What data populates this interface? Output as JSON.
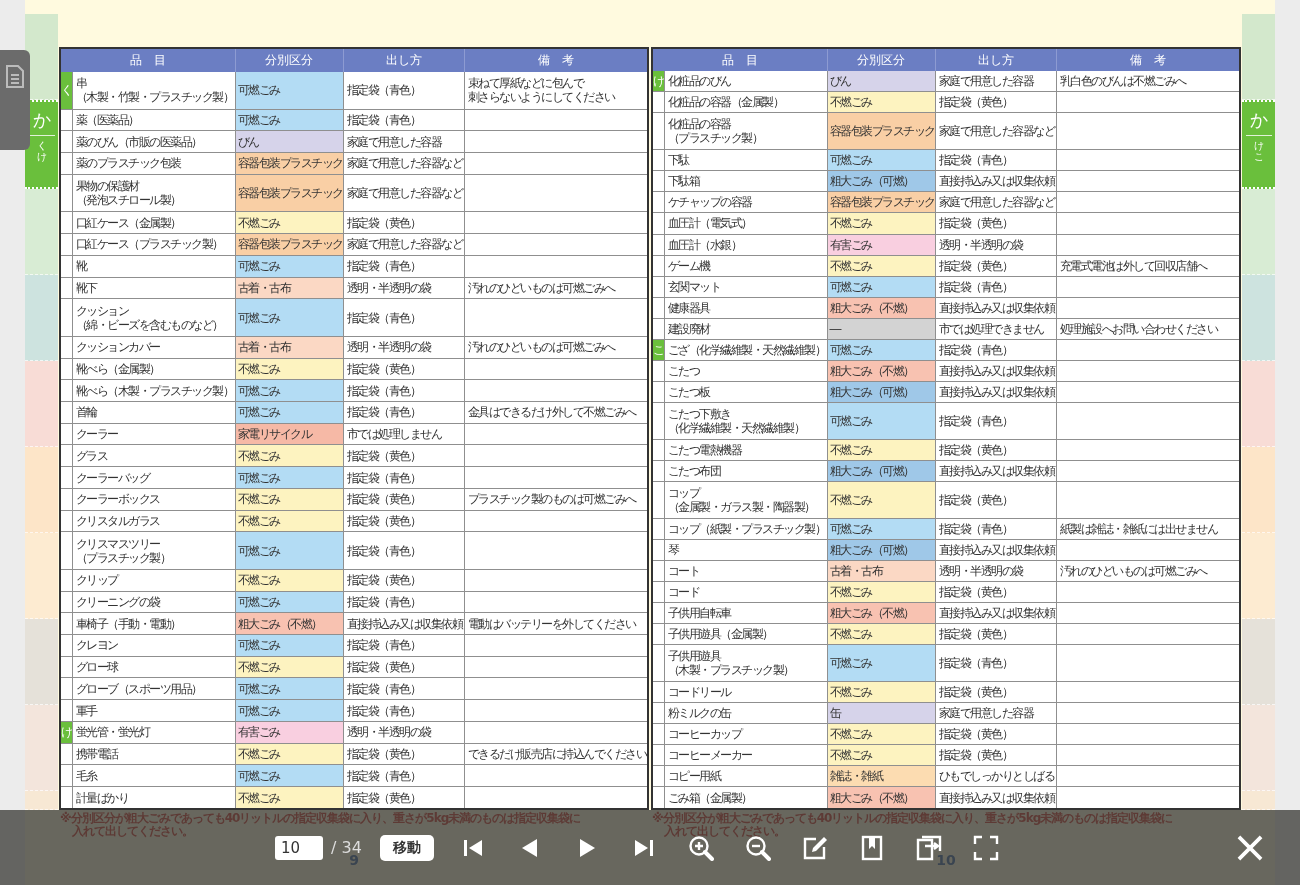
{
  "left_index": [
    {
      "color": "#d3e8cc",
      "selected": false
    },
    {
      "color": "#6abf3c",
      "selected": true,
      "label": "か",
      "sublabel": "くけ"
    },
    {
      "color": "#d8ecd4",
      "selected": false
    },
    {
      "color": "#cde3df",
      "selected": false
    },
    {
      "color": "#f8dcd6",
      "selected": false
    },
    {
      "color": "#fde5c8",
      "selected": false
    },
    {
      "color": "#fdebd1",
      "selected": false
    },
    {
      "color": "#e5e1d9",
      "selected": false
    },
    {
      "color": "#f3e5dc",
      "selected": false
    },
    {
      "color": "#f7e8d4",
      "selected": false
    }
  ],
  "pages": [
    {
      "columns": [
        "品　目",
        "分別区分",
        "出し方",
        "備　考"
      ],
      "rows": [
        {
          "index": "く",
          "item": [
            "串",
            "（木製・竹製・プラスチック製）"
          ],
          "category": "可燃ごみ",
          "color": "#b3dcf4",
          "method": "指定袋（青色）",
          "note": [
            "束ねて厚紙などに包んで",
            "刺さらないようにしてください"
          ]
        },
        {
          "item": "薬（医薬品）",
          "category": "可燃ごみ",
          "color": "#b3dcf4",
          "method": "指定袋（青色）"
        },
        {
          "item": "薬のびん（市販の医薬品）",
          "category": "びん",
          "color": "#d6d3ea",
          "method": "家庭で用意した容器"
        },
        {
          "item": "薬のプラスチック包装",
          "category": "容器包装プラスチック",
          "color": "#f9cfa5",
          "method": "家庭で用意した容器など"
        },
        {
          "item": [
            "果物の保護材",
            "（発泡スチロール製）"
          ],
          "category": "容器包装プラスチック",
          "color": "#f9cfa5",
          "method": "家庭で用意した容器など"
        },
        {
          "item": "口紅ケース（金属製）",
          "category": "不燃ごみ",
          "color": "#fdf3c0",
          "method": "指定袋（黄色）"
        },
        {
          "item": "口紅ケース（プラスチック製）",
          "category": "容器包装プラスチック",
          "color": "#f9cfa5",
          "method": "家庭で用意した容器など"
        },
        {
          "item": "靴",
          "category": "可燃ごみ",
          "color": "#b3dcf4",
          "method": "指定袋（青色）"
        },
        {
          "item": "靴下",
          "category": "古着・古布",
          "color": "#fbd8c4",
          "method": "透明・半透明の袋",
          "note": "汚れのひどいものは可燃ごみへ"
        },
        {
          "item": [
            "クッション",
            "（綿・ビーズを含むものなど）"
          ],
          "category": "可燃ごみ",
          "color": "#b3dcf4",
          "method": "指定袋（青色）"
        },
        {
          "item": "クッションカバー",
          "category": "古着・古布",
          "color": "#fbd8c4",
          "method": "透明・半透明の袋",
          "note": "汚れのひどいものは可燃ごみへ"
        },
        {
          "item": "靴べら（金属製）",
          "category": "不燃ごみ",
          "color": "#fdf3c0",
          "method": "指定袋（黄色）"
        },
        {
          "item": "靴べら（木製・プラスチック製）",
          "category": "可燃ごみ",
          "color": "#b3dcf4",
          "method": "指定袋（青色）"
        },
        {
          "item": "首輪",
          "category": "可燃ごみ",
          "color": "#b3dcf4",
          "method": "指定袋（青色）",
          "note": "金具はできるだけ外して不燃ごみへ"
        },
        {
          "item": "クーラー",
          "category": "家電リサイクル",
          "color": "#f6b9a6",
          "method": "市では処理しません"
        },
        {
          "item": "グラス",
          "category": "不燃ごみ",
          "color": "#fdf3c0",
          "method": "指定袋（黄色）"
        },
        {
          "item": "クーラーバッグ",
          "category": "可燃ごみ",
          "color": "#b3dcf4",
          "method": "指定袋（青色）"
        },
        {
          "item": "クーラーボックス",
          "category": "不燃ごみ",
          "color": "#fdf3c0",
          "method": "指定袋（黄色）",
          "note": "プラスチック製のものは可燃ごみへ"
        },
        {
          "item": "クリスタルガラス",
          "category": "不燃ごみ",
          "color": "#fdf3c0",
          "method": "指定袋（黄色）"
        },
        {
          "item": [
            "クリスマスツリー",
            "（プラスチック製）"
          ],
          "category": "可燃ごみ",
          "color": "#b3dcf4",
          "method": "指定袋（青色）"
        },
        {
          "item": "クリップ",
          "category": "不燃ごみ",
          "color": "#fdf3c0",
          "method": "指定袋（黄色）"
        },
        {
          "item": "クリーニングの袋",
          "category": "可燃ごみ",
          "color": "#b3dcf4",
          "method": "指定袋（青色）"
        },
        {
          "item": "車椅子（手動・電動）",
          "category": "粗大ごみ（不燃）",
          "color": "#f8c2b1",
          "method": "直接持込み又は収集依頼",
          "note": "電動はバッテリーを外してください"
        },
        {
          "item": "クレヨン",
          "category": "可燃ごみ",
          "color": "#b3dcf4",
          "method": "指定袋（青色）"
        },
        {
          "item": "グロー球",
          "category": "不燃ごみ",
          "color": "#fdf3c0",
          "method": "指定袋（黄色）"
        },
        {
          "item": "グローブ（スポーツ用品）",
          "category": "可燃ごみ",
          "color": "#b3dcf4",
          "method": "指定袋（青色）"
        },
        {
          "item": "軍手",
          "category": "可燃ごみ",
          "color": "#b3dcf4",
          "method": "指定袋（青色）"
        },
        {
          "index": "け",
          "item": "蛍光管・蛍光灯",
          "category": "有害ごみ",
          "color": "#f9cfe0",
          "method": "透明・半透明の袋"
        },
        {
          "item": "携帯電話",
          "category": "不燃ごみ",
          "color": "#fdf3c0",
          "method": "指定袋（黄色）",
          "note": "できるだけ販売店に持込んでください"
        },
        {
          "item": "毛糸",
          "category": "可燃ごみ",
          "color": "#b3dcf4",
          "method": "指定袋（青色）"
        },
        {
          "item": "計量ばかり",
          "category": "不燃ごみ",
          "color": "#fdf3c0",
          "method": "指定袋（黄色）"
        }
      ],
      "footnote": [
        "※分別区分が粗大ごみであっても40リットルの指定収集袋に入り、重さが5kg未満のものは指定収集袋に",
        "入れて出してください。"
      ],
      "page_number": "9"
    },
    {
      "columns": [
        "品　目",
        "分別区分",
        "出し方",
        "備　考"
      ],
      "rows": [
        {
          "index": "け",
          "item": "化粧品のびん",
          "category": "びん",
          "color": "#d6d3ea",
          "method": "家庭で用意した容器",
          "note": "乳白色のびんは不燃ごみへ"
        },
        {
          "item": "化粧品の容器（金属製）",
          "category": "不燃ごみ",
          "color": "#fdf3c0",
          "method": "指定袋（黄色）"
        },
        {
          "item": [
            "化粧品の容器",
            "（プラスチック製）"
          ],
          "category": "容器包装プラスチック",
          "color": "#f9cfa5",
          "method": "家庭で用意した容器など"
        },
        {
          "item": "下駄",
          "category": "可燃ごみ",
          "color": "#b3dcf4",
          "method": "指定袋（青色）"
        },
        {
          "item": "下駄箱",
          "category": "粗大ごみ（可燃）",
          "color": "#9fc8e8",
          "method": "直接持込み又は収集依頼"
        },
        {
          "item": "ケチャップの容器",
          "category": "容器包装プラスチック",
          "color": "#f9cfa5",
          "method": "家庭で用意した容器など"
        },
        {
          "item": "血圧計（電気式）",
          "category": "不燃ごみ",
          "color": "#fdf3c0",
          "method": "指定袋（黄色）"
        },
        {
          "item": "血圧計（水銀）",
          "category": "有害ごみ",
          "color": "#f9cfe0",
          "method": "透明・半透明の袋"
        },
        {
          "item": "ゲーム機",
          "category": "不燃ごみ",
          "color": "#fdf3c0",
          "method": "指定袋（黄色）",
          "note": "充電式電池は外して回収店舗へ"
        },
        {
          "item": "玄関マット",
          "category": "可燃ごみ",
          "color": "#b3dcf4",
          "method": "指定袋（青色）"
        },
        {
          "item": "健康器具",
          "category": "粗大ごみ（不燃）",
          "color": "#f8c2b1",
          "method": "直接持込み又は収集依頼"
        },
        {
          "item": "建設廃材",
          "category": "―",
          "color": "#d3d3d3",
          "method": "市では処理できません",
          "note": "処理施設へお問い合わせください"
        },
        {
          "index": "こ",
          "item": "ござ（化学繊維製・天然繊維製）",
          "category": "可燃ごみ",
          "color": "#b3dcf4",
          "method": "指定袋（青色）"
        },
        {
          "item": "こたつ",
          "category": "粗大ごみ（不燃）",
          "color": "#f8c2b1",
          "method": "直接持込み又は収集依頼"
        },
        {
          "item": "こたつ板",
          "category": "粗大ごみ（可燃）",
          "color": "#9fc8e8",
          "method": "直接持込み又は収集依頼"
        },
        {
          "item": [
            "こたつ下敷き",
            "（化学繊維製・天然繊維製）"
          ],
          "category": "可燃ごみ",
          "color": "#b3dcf4",
          "method": "指定袋（青色）"
        },
        {
          "item": "こたつ電熱機器",
          "category": "不燃ごみ",
          "color": "#fdf3c0",
          "method": "指定袋（黄色）"
        },
        {
          "item": "こたつ布団",
          "category": "粗大ごみ（可燃）",
          "color": "#9fc8e8",
          "method": "直接持込み又は収集依頼"
        },
        {
          "item": [
            "コップ",
            "（金属製・ガラス製・陶器製）"
          ],
          "category": "不燃ごみ",
          "color": "#fdf3c0",
          "method": "指定袋（黄色）"
        },
        {
          "item": "コップ（紙製・プラスチック製）",
          "category": "可燃ごみ",
          "color": "#b3dcf4",
          "method": "指定袋（青色）",
          "note": "紙製は雑誌・雑紙には出せません"
        },
        {
          "item": "琴",
          "category": "粗大ごみ（可燃）",
          "color": "#9fc8e8",
          "method": "直接持込み又は収集依頼"
        },
        {
          "item": "コート",
          "category": "古着・古布",
          "color": "#fbd8c4",
          "method": "透明・半透明の袋",
          "note": "汚れのひどいものは可燃ごみへ"
        },
        {
          "item": "コード",
          "category": "不燃ごみ",
          "color": "#fdf3c0",
          "method": "指定袋（黄色）"
        },
        {
          "item": "子供用自転車",
          "category": "粗大ごみ（不燃）",
          "color": "#f8c2b1",
          "method": "直接持込み又は収集依頼"
        },
        {
          "item": "子供用遊具（金属製）",
          "category": "不燃ごみ",
          "color": "#fdf3c0",
          "method": "指定袋（黄色）"
        },
        {
          "item": [
            "子供用遊具",
            "（木製・プラスチック製）"
          ],
          "category": "可燃ごみ",
          "color": "#b3dcf4",
          "method": "指定袋（青色）"
        },
        {
          "item": "コードリール",
          "category": "不燃ごみ",
          "color": "#fdf3c0",
          "method": "指定袋（黄色）"
        },
        {
          "item": "粉ミルクの缶",
          "category": "缶",
          "color": "#d6d3ea",
          "method": "家庭で用意した容器"
        },
        {
          "item": "コーヒーカップ",
          "category": "不燃ごみ",
          "color": "#fdf3c0",
          "method": "指定袋（黄色）"
        },
        {
          "item": "コーヒーメーカー",
          "category": "不燃ごみ",
          "color": "#fdf3c0",
          "method": "指定袋（黄色）"
        },
        {
          "item": "コピー用紙",
          "category": "雑誌・雑紙",
          "color": "#fcdcb1",
          "method": "ひもでしっかりとしばる"
        },
        {
          "item": "ごみ箱（金属製）",
          "category": "粗大ごみ（不燃）",
          "color": "#f8c2b1",
          "method": "直接持込み又は収集依頼"
        }
      ],
      "footnote": [
        "※分別区分が粗大ごみであっても40リットルの指定収集袋に入り、重さが5kg未満のものは指定収集袋に",
        "入れて出してください。"
      ],
      "page_number": "10"
    }
  ],
  "right_index": [
    {
      "color": "#d3e8cc",
      "selected": false
    },
    {
      "color": "#6abf3c",
      "selected": true,
      "label": "か",
      "sublabel": "けこ"
    },
    {
      "color": "#d8ecd4",
      "selected": false
    },
    {
      "color": "#cde3df",
      "selected": false
    },
    {
      "color": "#f8dcd6",
      "selected": false
    },
    {
      "color": "#fde5c8",
      "selected": false
    },
    {
      "color": "#fdebd1",
      "selected": false
    },
    {
      "color": "#e5e1d9",
      "selected": false
    },
    {
      "color": "#f3e5dc",
      "selected": false
    },
    {
      "color": "#f7e8d4",
      "selected": false
    }
  ],
  "toolbar": {
    "page_input": "10",
    "total": "/ 34",
    "go_button": "移動"
  }
}
